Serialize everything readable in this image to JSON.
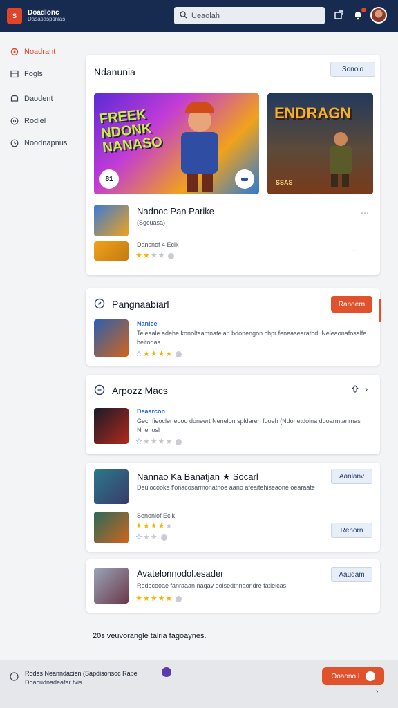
{
  "header": {
    "logo_text": "S",
    "brand_title": "Doadlonc",
    "brand_sub": "Dasasaspsnlas",
    "search_placeholder": "Ueaolah",
    "notif_icon": "bell-icon",
    "share_icon": "share-icon"
  },
  "sidebar": {
    "items": [
      {
        "label": "Noadrant",
        "icon": "target-icon",
        "active": true
      },
      {
        "label": "Fogls",
        "icon": "grid-icon",
        "active": false
      },
      {
        "label": "Daodent",
        "icon": "chat-icon",
        "active": false
      },
      {
        "label": "Rodiel",
        "icon": "compass-icon",
        "active": false
      },
      {
        "label": "Noodnapnus",
        "icon": "clock-icon",
        "active": false
      }
    ]
  },
  "featured": {
    "search_value": "Ndanunia",
    "button": "Sonolo",
    "banner1": {
      "text": "FREEK NDONK NANASO",
      "badge": "81",
      "colors": [
        "#6b2bd6",
        "#f08a1c"
      ]
    },
    "banner2": {
      "text": "ENDRAGN",
      "caption": "SSAS"
    },
    "game_title": "Nadnoc Pan Parike",
    "game_sub": "(Sgcuasa)",
    "game_meta": "Dansnof 4 Ecik",
    "game_rating": 2.5
  },
  "section1": {
    "title": "Pangnaabiarl",
    "button": "Ranoern",
    "item": {
      "name": "Nanice",
      "desc": "Teleaale adehe konoltaamnatelan bdonengon chpr feneasearatbd. Neleaonafosalfe beitodas...",
      "rating": 4
    }
  },
  "section2": {
    "title": "Arpozz Macs",
    "item": {
      "name": "Deaarcon",
      "desc": "Gecr fieocler eooo doneert Nenelon spldaren fooeh (Ndonetdoina dooarmtanmas Nnenosl",
      "rating": 1
    }
  },
  "section3": {
    "title": "Nannao Ka Banatjan ★ Socarl",
    "button": "Aanlanv",
    "desc": "Deulocooke f'onacosarmonatnoe aano afeaitehiseaone oearaate",
    "meta": "Senoniof Ecik",
    "rating1": 4,
    "rating2": 1,
    "button2": "Renorn"
  },
  "section4": {
    "title": "Avatelonnodol.esader",
    "button": "Aaudam",
    "desc": "Redecooae fanraaan naqav oolsedtnnaondre fatieicas.",
    "rating": 4
  },
  "footer_note": "20s veuvorangle talria fagoaynes.",
  "bottom": {
    "line1": "Rodes Neanndacien (Sapdisonsoc Rape",
    "line2": "Doacudnadeafar tvis.",
    "button": "Ooaono I",
    "icon": "info-icon"
  },
  "colors": {
    "accent": "#e0522b",
    "header": "#172a4f",
    "brand_blue": "#1e3a6e"
  }
}
